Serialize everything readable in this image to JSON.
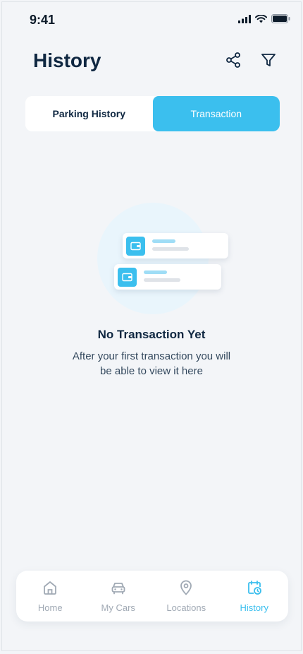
{
  "status": {
    "time": "9:41"
  },
  "header": {
    "title": "History"
  },
  "tabs": {
    "parking_history": "Parking History",
    "transaction": "Transaction"
  },
  "empty_state": {
    "title": "No Transaction Yet",
    "description": "After your first transaction you will be able to view it here"
  },
  "nav": {
    "items": [
      {
        "label": "Home",
        "icon": "home-icon"
      },
      {
        "label": "My Cars",
        "icon": "car-icon"
      },
      {
        "label": "Locations",
        "icon": "location-pin-icon"
      },
      {
        "label": "History",
        "icon": "history-calendar-icon"
      }
    ],
    "active_index": 3
  },
  "colors": {
    "accent": "#3bbfee",
    "text_dark": "#0f2741",
    "inactive": "#a0a9b4",
    "background": "#f3f5f8"
  }
}
